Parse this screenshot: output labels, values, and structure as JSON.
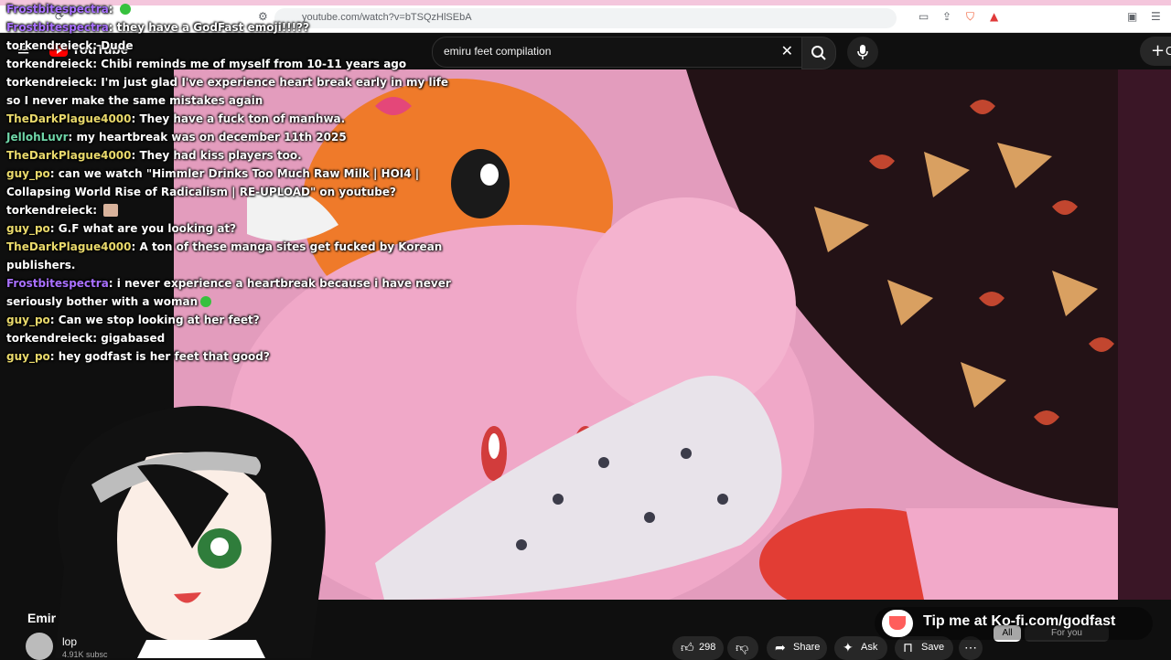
{
  "browser": {
    "url": "youtube.com/watch?v=bTSQzHlSEbA"
  },
  "youtube": {
    "logo_text": "YouTube",
    "search_query": "emiru feet compilation",
    "create_label": "C"
  },
  "chat": [
    {
      "user": "Frostbitespectra",
      "color": "#a970ff",
      "message": "",
      "emote": "green"
    },
    {
      "user": "Frostbitespectra",
      "color": "#a970ff",
      "message": "they have a GodFast emoji!!!??",
      "emote": ""
    },
    {
      "user": "torkendreieck",
      "color": "#ffffff",
      "message": "Dude",
      "emote": ""
    },
    {
      "user": "torkendreieck",
      "color": "#ffffff",
      "message": "Chibi reminds me of myself from 10-11 years ago",
      "emote": ""
    },
    {
      "user": "torkendreieck",
      "color": "#ffffff",
      "message": "I'm just glad I've experience heart break early in my life so I never make the same mistakes again",
      "emote": ""
    },
    {
      "user": "TheDarkPlague4000",
      "color": "#e9d96b",
      "message": "They have a fuck ton of manhwa.",
      "emote": ""
    },
    {
      "user": "JellohLuvr",
      "color": "#6fd6a8",
      "message": "my heartbreak was on december 11th 2025",
      "emote": ""
    },
    {
      "user": "TheDarkPlague4000",
      "color": "#e9d96b",
      "message": "They had kiss players too.",
      "emote": ""
    },
    {
      "user": "guy_po",
      "color": "#e9d96b",
      "message": "can we watch \"Himmler Drinks Too Much Raw Milk | HOI4 | Collapsing World Rise of Radicalism | RE-UPLOAD\" on youtube?",
      "emote": ""
    },
    {
      "user": "torkendreieck",
      "color": "#ffffff",
      "message": "",
      "emote": "face"
    },
    {
      "user": "guy_po",
      "color": "#e9d96b",
      "message": "G.F what are you looking at?",
      "emote": ""
    },
    {
      "user": "TheDarkPlague4000",
      "color": "#e9d96b",
      "message": "A ton of these manga sites get fucked by Korean publishers.",
      "emote": ""
    },
    {
      "user": "Frostbitespectra",
      "color": "#a970ff",
      "message": "i never experience a heartbreak because i have never seriously bother with a woman",
      "emote": "green"
    },
    {
      "user": "guy_po",
      "color": "#e9d96b",
      "message": "Can we stop looking at her feet?",
      "emote": ""
    },
    {
      "user": "torkendreieck",
      "color": "#ffffff",
      "message": "gigabased",
      "emote": ""
    },
    {
      "user": "guy_po",
      "color": "#e9d96b",
      "message": "hey godfast is her feet that good?",
      "emote": ""
    }
  ],
  "video": {
    "title": "Emir",
    "channel_name": "lop",
    "channel_subs": "4.91K subsc",
    "likes": "298",
    "share_label": "Share",
    "ask_label": "Ask",
    "save_label": "Save"
  },
  "kofi": {
    "text": "Tip me at Ko-fi.com/godfast"
  },
  "chips": {
    "all": "All",
    "for_you": "For you"
  },
  "colors": {
    "youtube_red": "#ff0000",
    "video_pink": "#e8a2c3",
    "kofi_red": "#ff5e5b"
  }
}
